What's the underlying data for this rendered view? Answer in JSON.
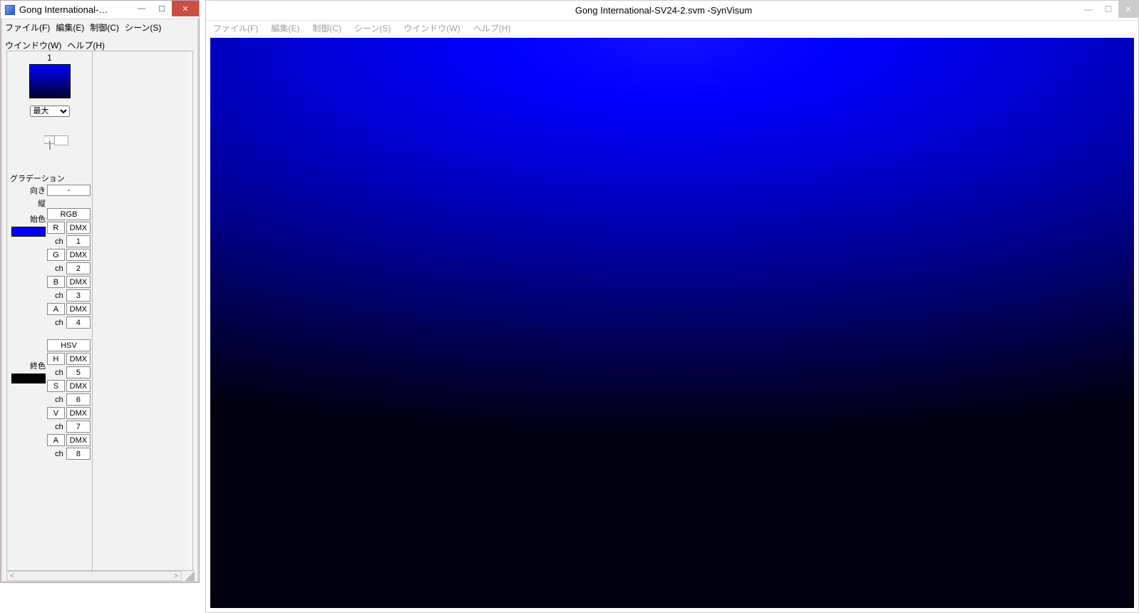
{
  "main_window": {
    "title": "Gong International-SV24-2.svm -SynVisum",
    "menu": {
      "file": "ファイル(F)",
      "edit": "編集(E)",
      "control": "制御(C)",
      "scene": "シーン(S)",
      "window": "ウインドウ(W)",
      "help": "ヘルプ(H)"
    },
    "minimize_glyph": "—",
    "maximize_glyph": "☐",
    "close_glyph": "✕"
  },
  "tool_window": {
    "title": "Gong International-…",
    "menu": {
      "file": "ファイル(F)",
      "edit": "編集(E)",
      "control": "制御(C)",
      "scene": "シーン(S)",
      "window": "ウインドウ(W)",
      "help": "ヘルプ(H)"
    },
    "minimize_glyph": "—",
    "maximize_glyph": "☐",
    "close_glyph": "✕",
    "frame": {
      "index": "1",
      "mode_select_value": "最大"
    },
    "gradation": {
      "section_label": "グラデーション",
      "direction_label": "向き",
      "direction_value": "-",
      "vertical_label": "縦",
      "start_color": {
        "label": "始色",
        "mode": "RGB",
        "swatch": "#0000ff",
        "channels": [
          {
            "letter": "R",
            "dmx": "DMX",
            "ch_label": "ch",
            "ch_value": "1"
          },
          {
            "letter": "G",
            "dmx": "DMX",
            "ch_label": "ch",
            "ch_value": "2"
          },
          {
            "letter": "B",
            "dmx": "DMX",
            "ch_label": "ch",
            "ch_value": "3"
          },
          {
            "letter": "A",
            "dmx": "DMX",
            "ch_label": "ch",
            "ch_value": "4"
          }
        ]
      },
      "end_color": {
        "label": "終色",
        "mode": "HSV",
        "swatch": "#000000",
        "channels": [
          {
            "letter": "H",
            "dmx": "DMX",
            "ch_label": "ch",
            "ch_value": "5"
          },
          {
            "letter": "S",
            "dmx": "DMX",
            "ch_label": "ch",
            "ch_value": "6"
          },
          {
            "letter": "V",
            "dmx": "DMX",
            "ch_label": "ch",
            "ch_value": "7"
          },
          {
            "letter": "A",
            "dmx": "DMX",
            "ch_label": "ch",
            "ch_value": "8"
          }
        ]
      }
    },
    "hscroll": {
      "left": "<",
      "right": ">"
    }
  }
}
